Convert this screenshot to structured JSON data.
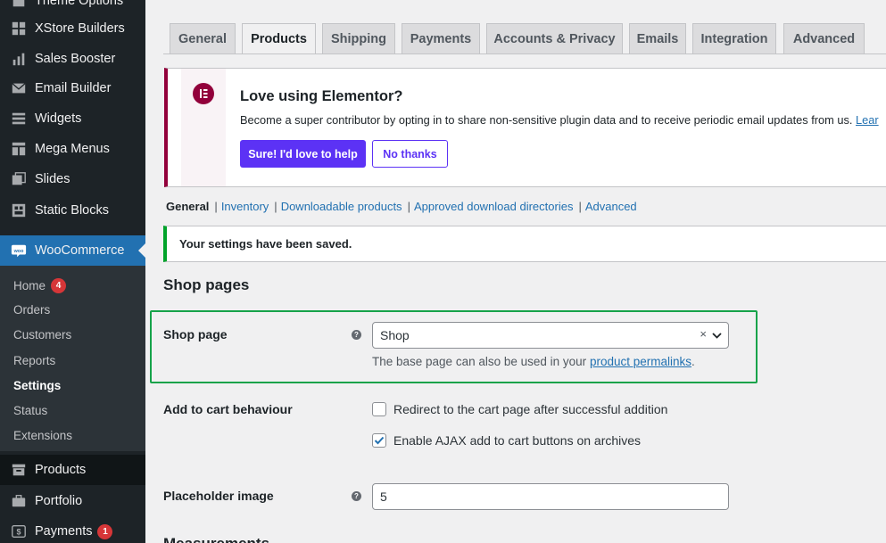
{
  "sidebar": {
    "items": [
      {
        "label": "Theme Options",
        "icon": "theme-options-icon"
      },
      {
        "label": "XStore Builders",
        "icon": "grid-icon"
      },
      {
        "label": "Sales Booster",
        "icon": "bar-chart-icon"
      },
      {
        "label": "Email Builder",
        "icon": "envelope-icon"
      },
      {
        "label": "Widgets",
        "icon": "widgets-icon"
      },
      {
        "label": "Mega Menus",
        "icon": "mega-menu-icon"
      },
      {
        "label": "Slides",
        "icon": "slides-icon"
      },
      {
        "label": "Static Blocks",
        "icon": "blocks-icon"
      },
      {
        "label": "WooCommerce",
        "icon": "woocommerce-icon"
      },
      {
        "label": "Products",
        "icon": "archive-icon"
      },
      {
        "label": "Portfolio",
        "icon": "portfolio-icon"
      },
      {
        "label": "Payments",
        "icon": "payments-icon",
        "badge": "1"
      }
    ],
    "submenu": [
      {
        "label": "Home",
        "badge": "4"
      },
      {
        "label": "Orders"
      },
      {
        "label": "Customers"
      },
      {
        "label": "Reports"
      },
      {
        "label": "Settings"
      },
      {
        "label": "Status"
      },
      {
        "label": "Extensions"
      }
    ]
  },
  "tabs": [
    "General",
    "Products",
    "Shipping",
    "Payments",
    "Accounts & Privacy",
    "Emails",
    "Integration",
    "Advanced"
  ],
  "active_tab": "Products",
  "notice": {
    "title": "Love using Elementor?",
    "text": "Become a super contributor by opting in to share non-sensitive plugin data and to receive periodic email updates from us.",
    "link": "Lear",
    "primary_button": "Sure! I'd love to help",
    "secondary_button": "No thanks"
  },
  "subnav": [
    "General",
    "Inventory",
    "Downloadable products",
    "Approved download directories",
    "Advanced"
  ],
  "saved_message": "Your settings have been saved.",
  "section_title": "Shop pages",
  "shop_page": {
    "label": "Shop page",
    "help": "?",
    "value": "Shop",
    "clear": "×",
    "desc_prefix": "The base page can also be used in your",
    "desc_link": "product permalinks",
    "desc_suffix": "."
  },
  "add_to_cart": {
    "label": "Add to cart behaviour",
    "options": [
      {
        "label": "Redirect to the cart page after successful addition",
        "checked": false
      },
      {
        "label": "Enable AJAX add to cart buttons on archives",
        "checked": true
      }
    ]
  },
  "placeholder_image": {
    "label": "Placeholder image",
    "help": "?",
    "value": "5"
  },
  "next_section": "Measurements",
  "colors": {
    "sidebar_bg": "#1d2327",
    "accent": "#2271b1",
    "elementor": "#92003b",
    "elementor_button": "#5c32f5",
    "success": "#00a32a",
    "highlight": "#16a34a"
  }
}
